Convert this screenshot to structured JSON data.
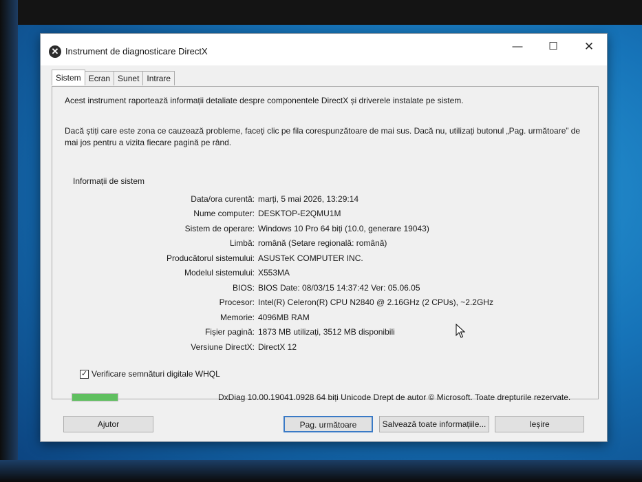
{
  "window": {
    "title": "Instrument de diagnosticare DirectX",
    "minimize": "—",
    "maximize": "☐",
    "close": "✕"
  },
  "tabs": [
    {
      "label": "Sistem"
    },
    {
      "label": "Ecran"
    },
    {
      "label": "Sunet"
    },
    {
      "label": "Intrare"
    }
  ],
  "intro": {
    "line1": "Acest instrument raportează informații detaliate despre componentele DirectX și driverele instalate pe sistem.",
    "line2": "Dacă știți care este zona ce cauzează probleme, faceți clic pe fila corespunzătoare de mai sus. Dacă nu, utilizați butonul „Pag. următoare” de mai jos pentru a vizita fiecare pagină pe rând."
  },
  "system_info": {
    "group_label": "Informații de sistem",
    "rows": [
      {
        "label": "Data/ora curentă:",
        "value": "marți, 5 mai 2026, 13:29:14"
      },
      {
        "label": "Nume computer:",
        "value": "DESKTOP-E2QMU1M"
      },
      {
        "label": "Sistem de operare:",
        "value": "Windows 10 Pro 64 biți (10.0, generare 19043)"
      },
      {
        "label": "Limbă:",
        "value": "română (Setare regională: română)"
      },
      {
        "label": "Producătorul sistemului:",
        "value": "ASUSTeK COMPUTER INC."
      },
      {
        "label": "Modelul sistemului:",
        "value": "X553MA"
      },
      {
        "label": "BIOS:",
        "value": "BIOS Date: 08/03/15 14:37:42 Ver: 05.06.05"
      },
      {
        "label": "Procesor:",
        "value": "Intel(R) Celeron(R) CPU  N2840  @ 2.16GHz (2 CPUs), ~2.2GHz"
      },
      {
        "label": "Memorie:",
        "value": "4096MB RAM"
      },
      {
        "label": "Fișier pagină:",
        "value": "1873 MB utilizați, 3512 MB disponibili"
      },
      {
        "label": "Versiune DirectX:",
        "value": "DirectX 12"
      }
    ]
  },
  "whql": {
    "label": "Verificare semnături digitale WHQL",
    "checked": true,
    "mark": "✓"
  },
  "progress": {
    "fraction": 1.0
  },
  "footer_text": "DxDiag 10.00.19041.0928 64 biți Unicode  Drept de autor © Microsoft. Toate drepturile rezervate.",
  "buttons": {
    "help": "Ajutor",
    "next": "Pag. următoare",
    "save": "Salvează toate informațiile...",
    "exit": "Ieșire"
  }
}
